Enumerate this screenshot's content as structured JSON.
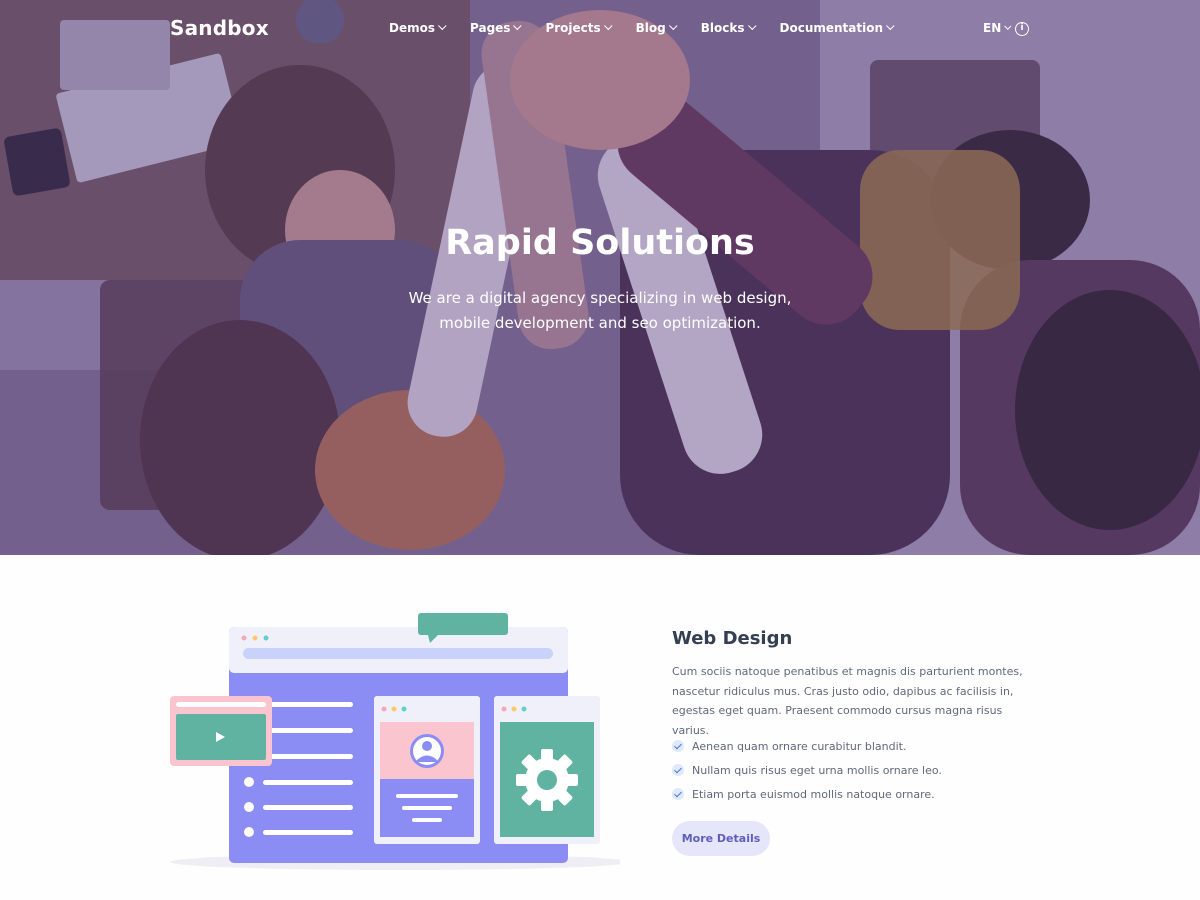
{
  "nav": {
    "logo": "Sandbox",
    "menu": [
      {
        "label": "Demos"
      },
      {
        "label": "Pages"
      },
      {
        "label": "Projects"
      },
      {
        "label": "Blog"
      },
      {
        "label": "Blocks"
      },
      {
        "label": "Documentation"
      }
    ],
    "language": "EN",
    "info_icon": "info-icon"
  },
  "hero": {
    "title": "Rapid Solutions",
    "subtitle": "We are a digital agency specializing in web design, mobile development and seo optimization."
  },
  "feature": {
    "title": "Web Design",
    "description": "Cum sociis natoque penatibus et magnis dis parturient montes, nascetur ridiculus mus. Cras justo odio, dapibus ac facilisis in, egestas eget quam. Praesent commodo cursus magna risus varius.",
    "checklist": [
      "Aenean quam ornare curabitur blandit.",
      "Nullam quis risus eget urna mollis ornare leo.",
      "Etiam porta euismod mollis natoque ornare."
    ],
    "button_label": "More Details"
  },
  "colors": {
    "accent": "#605dba",
    "lavender": "#8c8cf5",
    "teal": "#5fb3a0",
    "pink": "#fbc5cf",
    "text": "#343f52",
    "muted": "#60697b"
  }
}
